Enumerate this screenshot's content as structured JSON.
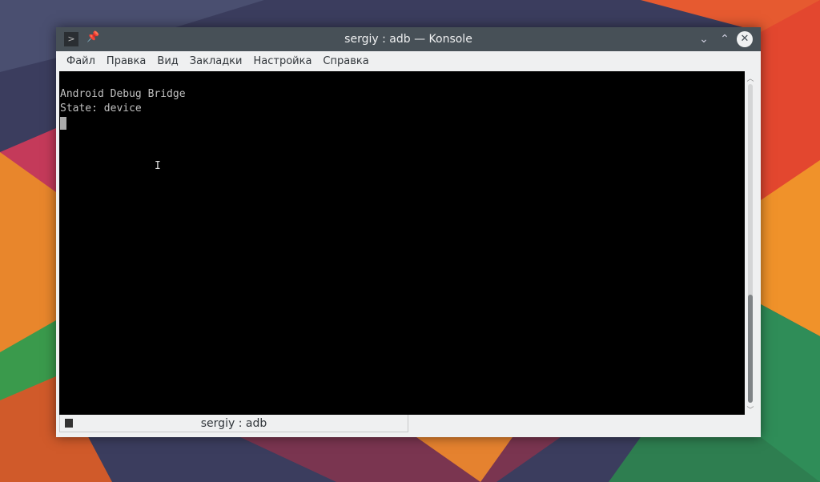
{
  "window": {
    "title": "sergiy : adb — Konsole"
  },
  "menu": [
    "Файл",
    "Правка",
    "Вид",
    "Закладки",
    "Настройка",
    "Справка"
  ],
  "terminal": {
    "lines": [
      "Android Debug Bridge",
      "State: device"
    ]
  },
  "tab": {
    "label": "sergiy : adb"
  },
  "icons": {
    "app": "terminal-icon",
    "pin": "pin-icon",
    "minimize": "chevron-down-icon",
    "maximize": "chevron-up-icon",
    "close": "close-icon"
  }
}
